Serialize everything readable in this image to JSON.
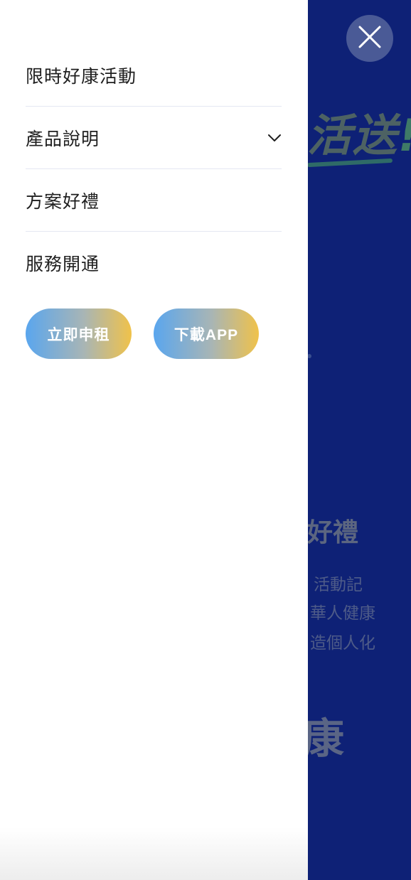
{
  "background": {
    "headline": "活送",
    "headline_mark": "!",
    "subtitle": "好禮",
    "lines": [
      "活動記",
      "華人健康",
      "造個人化"
    ],
    "big_text": "康"
  },
  "menu": {
    "items": [
      {
        "label": "限時好康活動",
        "has_dropdown": false
      },
      {
        "label": "產品說明",
        "has_dropdown": true,
        "icon": "chevron-down-icon"
      },
      {
        "label": "方案好禮",
        "has_dropdown": false
      },
      {
        "label": "服務開通",
        "has_dropdown": false
      }
    ]
  },
  "buttons": {
    "apply_label": "立即申租",
    "download_label": "下載APP"
  },
  "close": {
    "icon": "close-icon"
  },
  "colors": {
    "overlay_blue": "#0e2176",
    "button_gradient": [
      "#5aa6ee",
      "#f0c24a"
    ],
    "close_button": "#4a5a96"
  }
}
